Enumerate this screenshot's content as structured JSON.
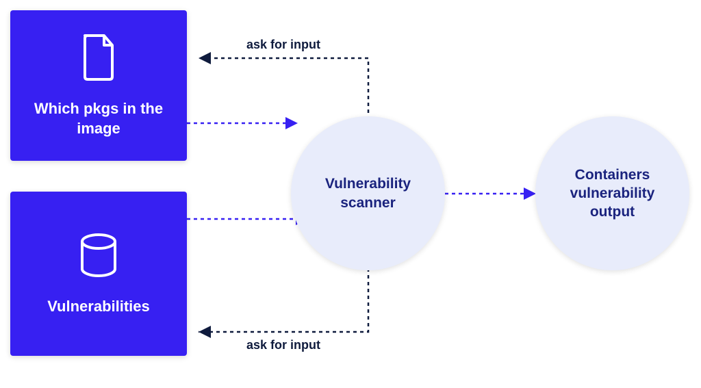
{
  "boxes": {
    "pkgs": {
      "label": "Which pkgs in the image",
      "icon": "document-icon"
    },
    "vulns": {
      "label": "Vulnerabilities",
      "icon": "database-icon"
    }
  },
  "circles": {
    "scanner": {
      "label": "Vulnerability scanner"
    },
    "output": {
      "label": "Containers vulnerability output"
    }
  },
  "edges": {
    "ask_top": {
      "label": "ask for input"
    },
    "ask_bottom": {
      "label": "ask for input"
    }
  },
  "colors": {
    "box_bg": "#3720f2",
    "circle_bg": "#e8ecfb",
    "dark": "#0f1b3d",
    "blue": "#3720f2"
  }
}
